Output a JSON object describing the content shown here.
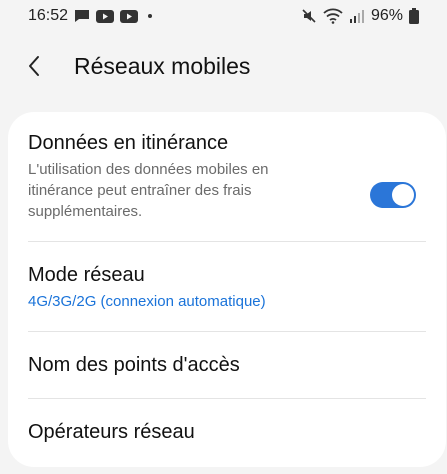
{
  "status_bar": {
    "time": "16:52",
    "battery": "96%",
    "icons_left": [
      "message-icon",
      "youtube-icon",
      "youtube-icon",
      "dot"
    ],
    "icons_right": [
      "mute-icon",
      "wifi-icon",
      "signal-icon",
      "battery-icon"
    ]
  },
  "header": {
    "back_icon": "back-arrow-icon",
    "title": "Réseaux mobiles"
  },
  "settings": {
    "roaming": {
      "title": "Données en itinérance",
      "subtitle": "L'utilisation des données mobiles en itinérance peut entraîner des frais supplémentaires.",
      "enabled": true
    },
    "network_mode": {
      "title": "Mode réseau",
      "value": "4G/3G/2G (connexion automatique)"
    },
    "apn": {
      "title": "Nom des points d'accès"
    },
    "operators": {
      "title": "Opérateurs réseau"
    }
  },
  "colors": {
    "accent": "#2b76d8",
    "link": "#1a73d9",
    "background": "#f4f4f4",
    "card": "#ffffff"
  }
}
